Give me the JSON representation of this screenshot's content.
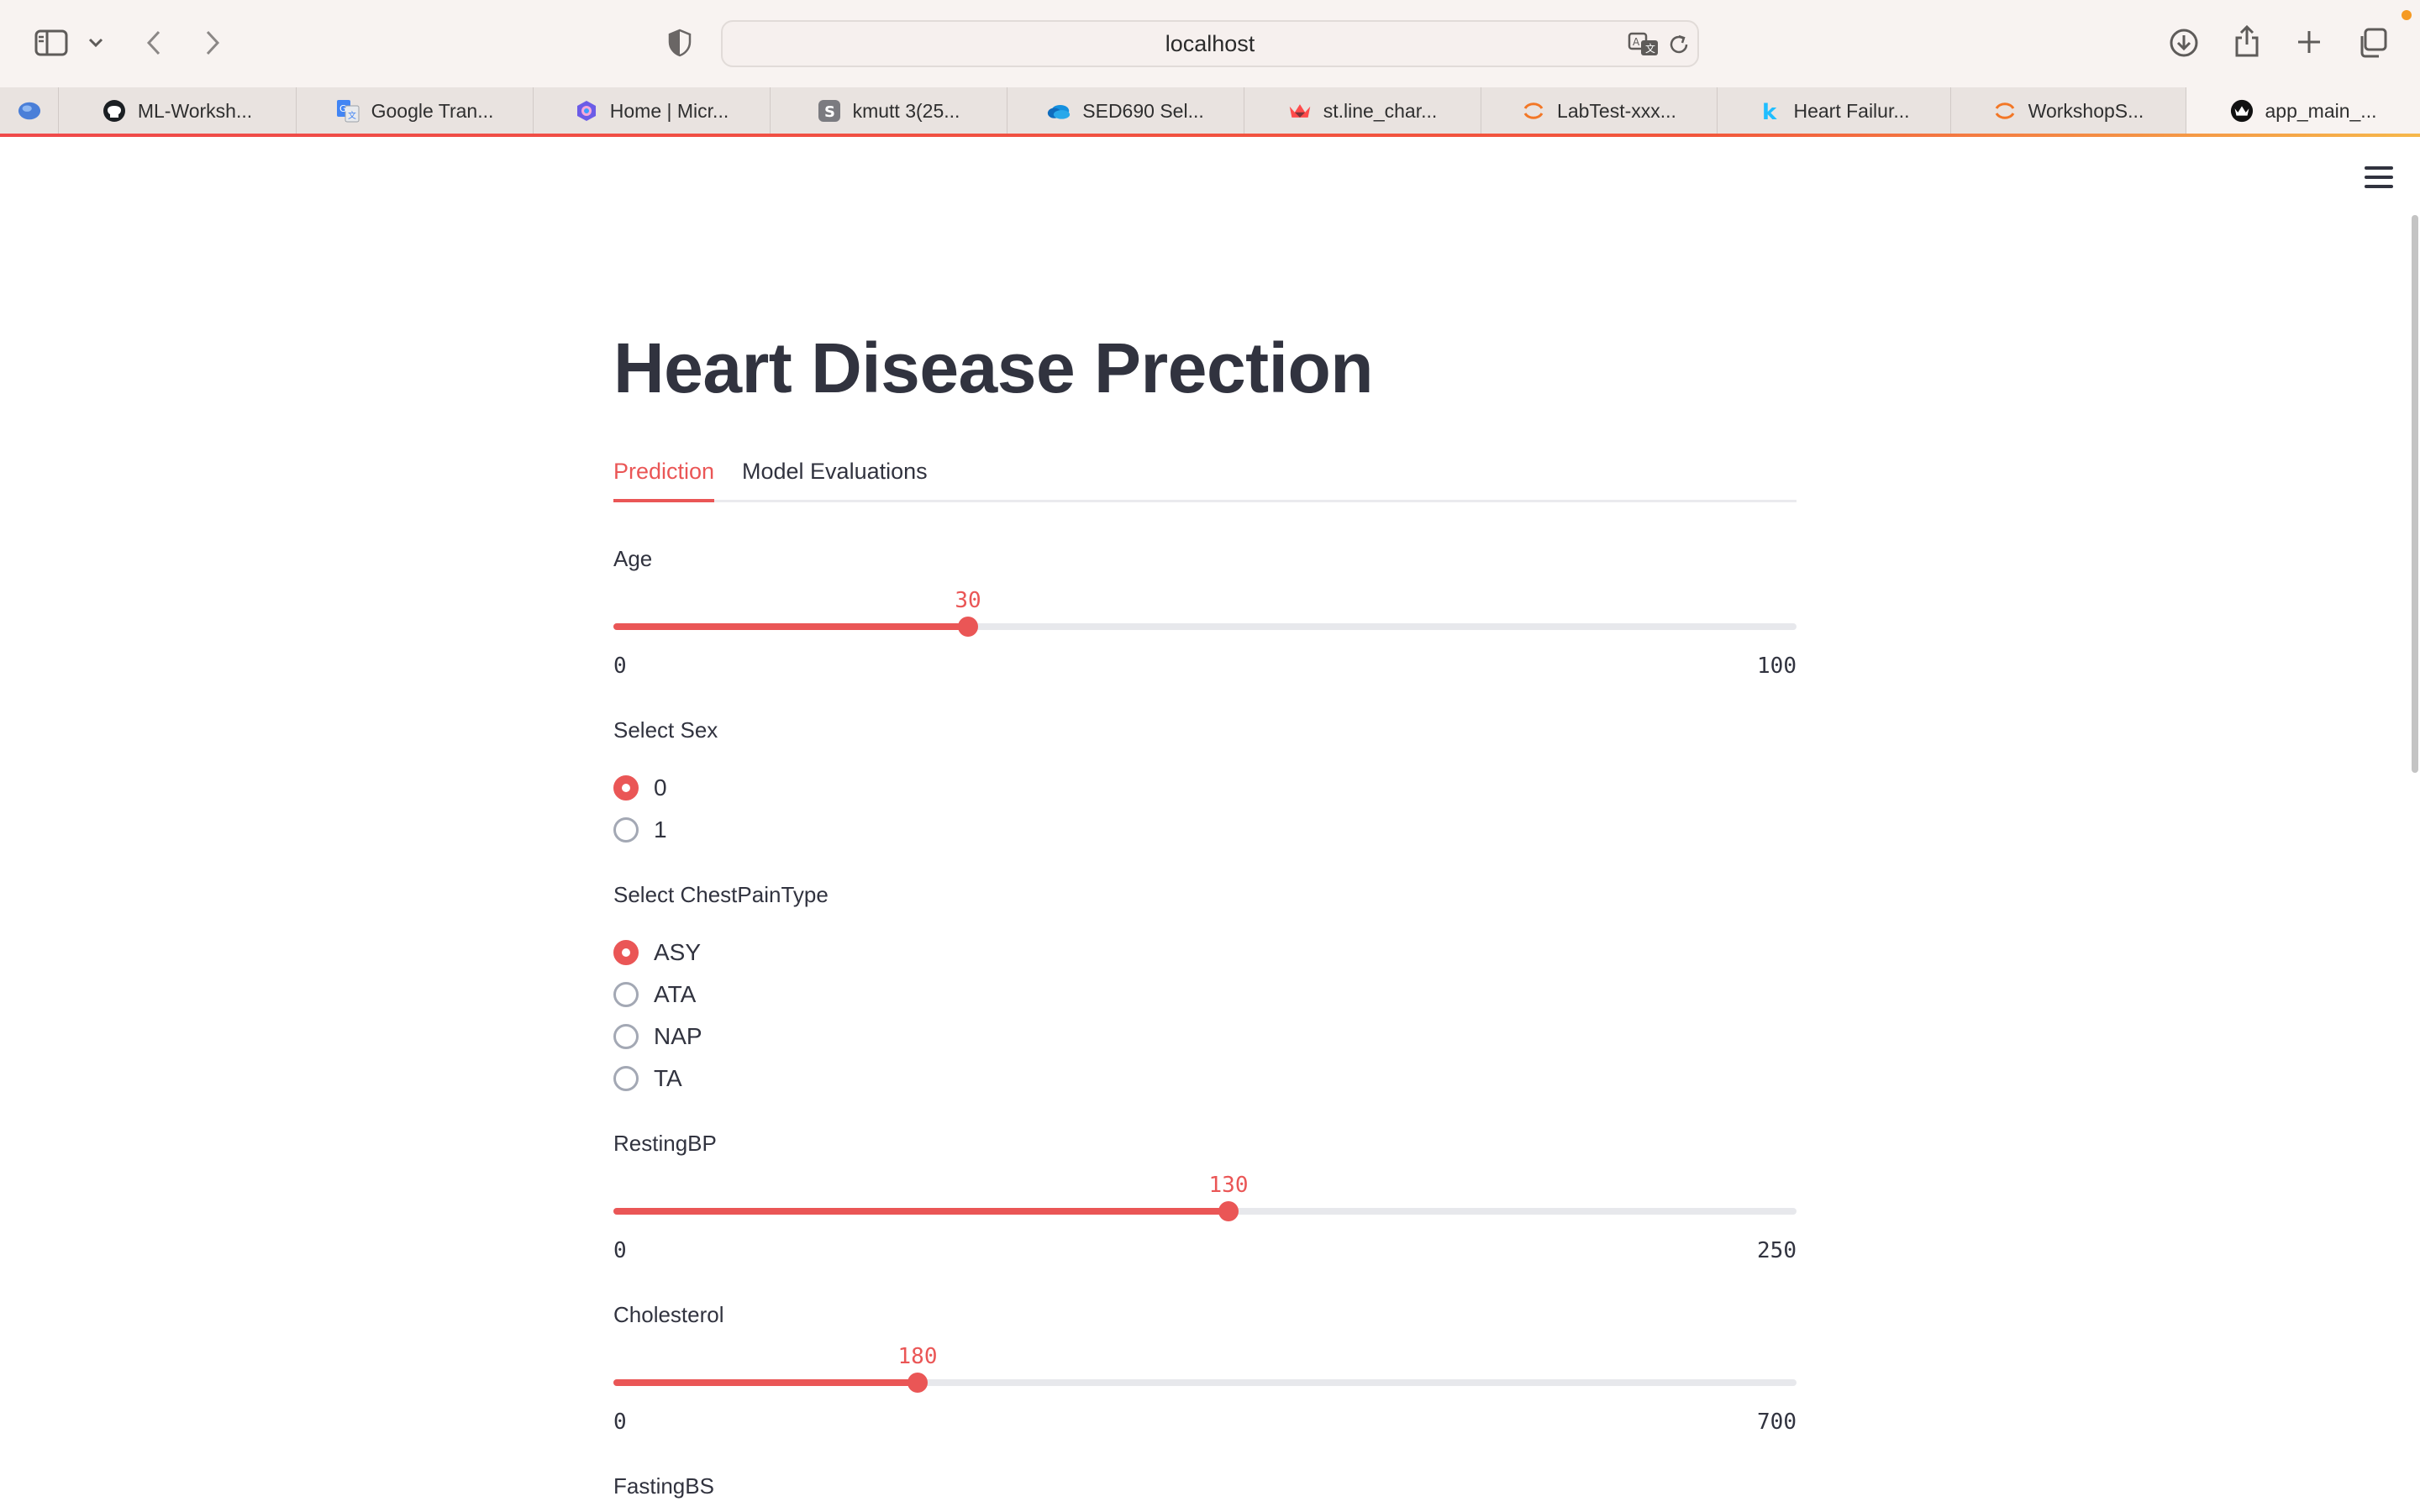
{
  "browser": {
    "url": "localhost",
    "tabs": [
      {
        "label": "",
        "icon": "blue-globe-icon"
      },
      {
        "label": "ML-Worksh...",
        "icon": "github-icon"
      },
      {
        "label": "Google Tran...",
        "icon": "google-translate-icon"
      },
      {
        "label": "Home | Micr...",
        "icon": "microsoft-copilot-icon"
      },
      {
        "label": "kmutt 3(25...",
        "icon": "s-letter-icon"
      },
      {
        "label": "SED690 Sel...",
        "icon": "onedrive-cloud-icon"
      },
      {
        "label": "st.line_char...",
        "icon": "streamlit-crown-icon"
      },
      {
        "label": "LabTest-xxx...",
        "icon": "jupyter-icon"
      },
      {
        "label": "Heart Failur...",
        "icon": "kaggle-icon"
      },
      {
        "label": "WorkshopS...",
        "icon": "jupyter-icon"
      },
      {
        "label": "app_main_...",
        "icon": "streamlit-app-icon",
        "active": true
      }
    ]
  },
  "app": {
    "title": "Heart Disease Prection",
    "tabs": [
      {
        "label": "Prediction",
        "active": true
      },
      {
        "label": "Model Evaluations",
        "active": false
      }
    ],
    "age": {
      "label": "Age",
      "value": "30",
      "min": "0",
      "max": "100",
      "fraction": 0.3
    },
    "sex": {
      "label": "Select Sex",
      "options": [
        "0",
        "1"
      ],
      "selected": "0"
    },
    "chest_pain": {
      "label": "Select ChestPainType",
      "options": [
        "ASY",
        "ATA",
        "NAP",
        "TA"
      ],
      "selected": "ASY"
    },
    "resting_bp": {
      "label": "RestingBP",
      "value": "130",
      "min": "0",
      "max": "250",
      "fraction": 0.52
    },
    "cholesterol": {
      "label": "Cholesterol",
      "value": "180",
      "min": "0",
      "max": "700",
      "fraction": 0.2571
    },
    "fasting_bs": {
      "label": "FastingBS"
    }
  },
  "colors": {
    "accent": "#ea5656",
    "text": "#31333f"
  }
}
